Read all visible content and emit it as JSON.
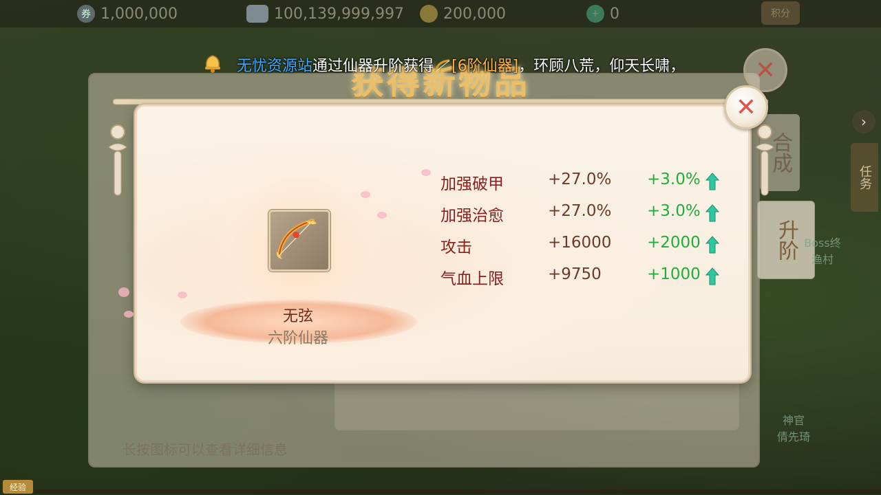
{
  "currencies": [
    {
      "icon": "jade-coin-icon",
      "value": "1,000,000"
    },
    {
      "icon": "silver-ingot-icon",
      "value": "100,139,999,997"
    },
    {
      "icon": "gold-coin-icon",
      "value": "200,000"
    },
    {
      "icon": "green-gem-icon",
      "value": "0"
    }
  ],
  "score_button": "积分",
  "broadcast": {
    "player": "无忧资源站",
    "text1": "通过仙器升阶获得",
    "item": "[6阶仙器]",
    "text2": "，环顾八荒，仰天长啸，"
  },
  "banner_title": "获得新物品",
  "background": {
    "hint": "长按图标可以查看详细信息",
    "side_tabs": {
      "tab_a": "合成",
      "tab_b": "升阶"
    },
    "task_tab": "任务",
    "npc_right": "神官\n倩先琦",
    "npc_mid": "Boss终\n渔村",
    "exp_label": "经验"
  },
  "item": {
    "name": "无弦",
    "rank": "六阶仙器",
    "icon": "golden-bow-icon"
  },
  "stats": [
    {
      "name": "加强破甲",
      "base": "+27.0%",
      "bonus": "+3.0%"
    },
    {
      "name": "加强治愈",
      "base": "+27.0%",
      "bonus": "+3.0%"
    },
    {
      "name": "攻击",
      "base": "+16000",
      "bonus": "+2000"
    },
    {
      "name": "气血上限",
      "base": "+9750",
      "bonus": "+1000"
    }
  ],
  "colors": {
    "stat_name": "#8a1e1e",
    "bonus": "#1fae3a",
    "player_name": "#3fa9ff",
    "item_highlight": "#ffb347"
  }
}
